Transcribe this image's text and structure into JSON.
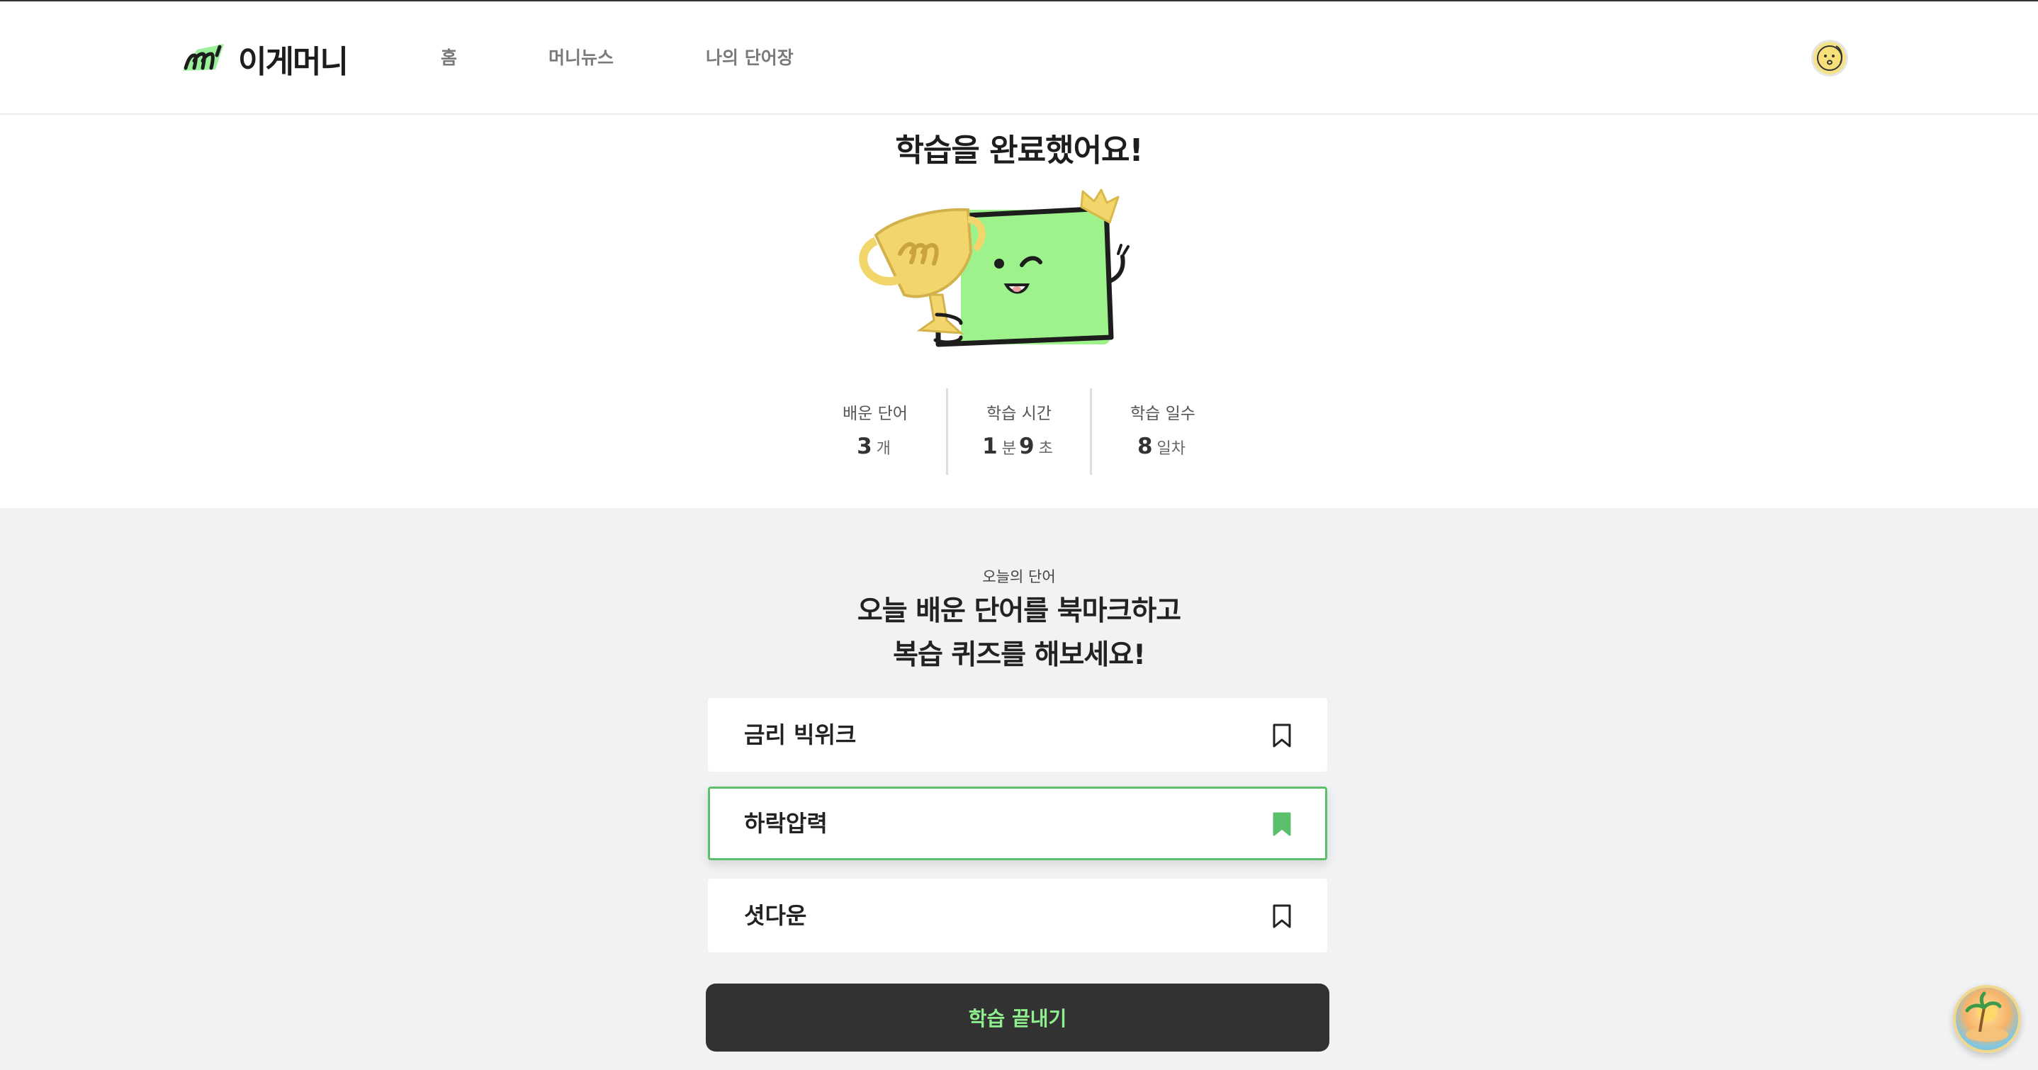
{
  "header": {
    "logo_text": "이게머니",
    "nav": [
      {
        "label": "홈"
      },
      {
        "label": "머니뉴스"
      },
      {
        "label": "나의 단어장"
      }
    ]
  },
  "completion": {
    "title": "학습을 완료했어요!",
    "stats": [
      {
        "label": "배운 단어",
        "parts": [
          {
            "num": "3",
            "unit": "개"
          }
        ]
      },
      {
        "label": "학습 시간",
        "parts": [
          {
            "num": "1",
            "unit": "분"
          },
          {
            "num": "9",
            "unit": "초"
          }
        ]
      },
      {
        "label": "학습 일수",
        "parts": [
          {
            "num": "8",
            "unit": "일차"
          }
        ]
      }
    ]
  },
  "words_section": {
    "sub_label": "오늘의 단어",
    "headline_line1": "오늘 배운 단어를 북마크하고",
    "headline_line2": "복습 퀴즈를 해보세요!",
    "words": [
      {
        "text": "금리 빅위크",
        "bookmarked": false
      },
      {
        "text": "하락압력",
        "bookmarked": true
      },
      {
        "text": "셧다운",
        "bookmarked": false
      }
    ],
    "finish_button": "학습 끝내기"
  },
  "colors": {
    "accent_green": "#5cbf6c",
    "button_dark": "#323232",
    "button_text": "#8fef8f",
    "mascot_green": "#9ef28b",
    "trophy_gold": "#f2d66b"
  }
}
